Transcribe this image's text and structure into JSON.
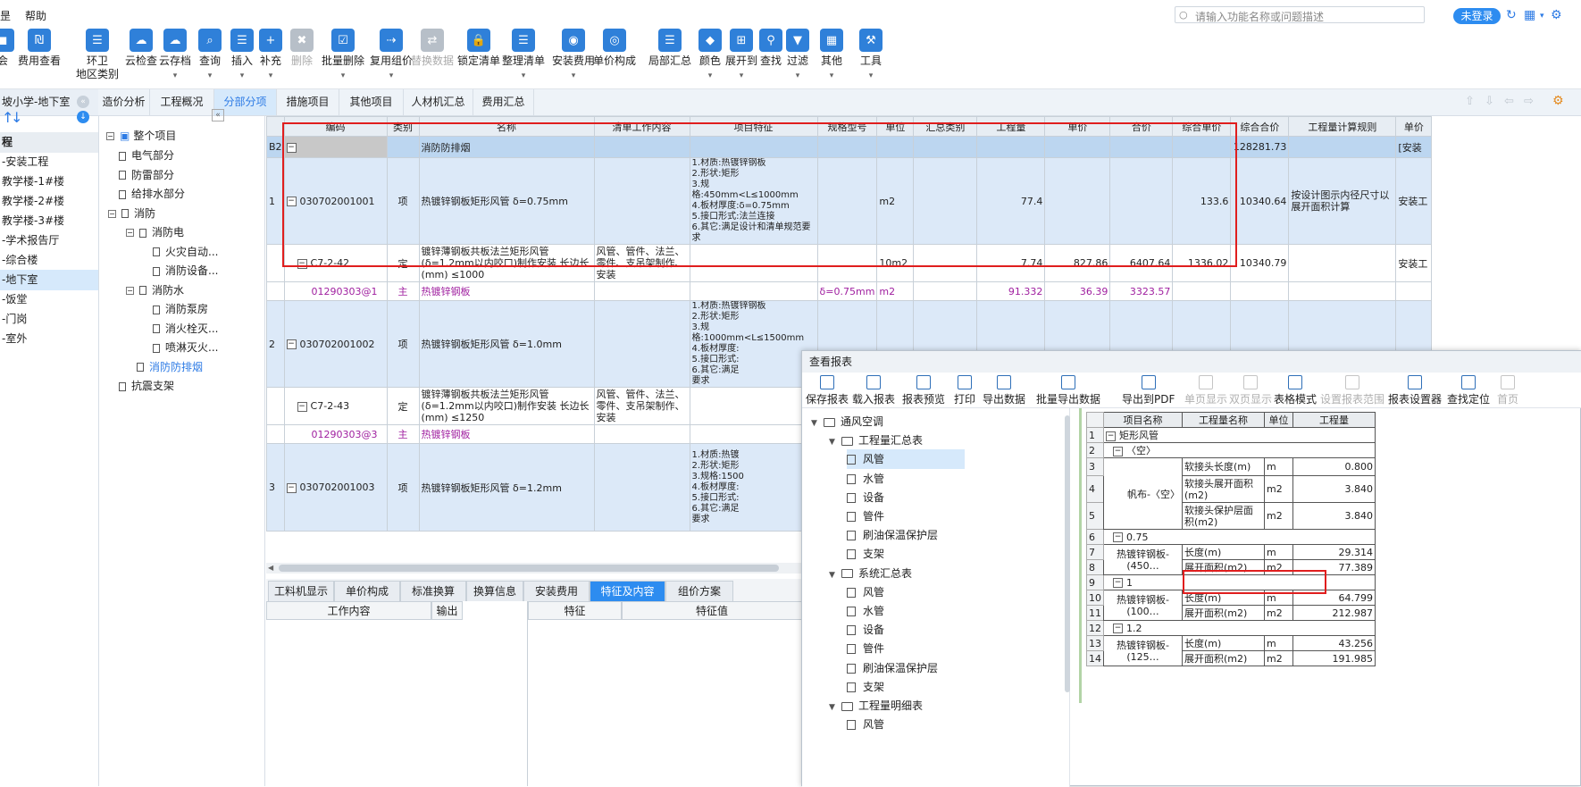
{
  "menubar": {
    "left_stub": "昰",
    "help": "帮助",
    "search_placeholder": "请输入功能名称或问题描述",
    "login": "未登录"
  },
  "toolbar": [
    {
      "label": "会",
      "sub": "",
      "dis": false
    },
    {
      "label": "费用查看",
      "sub": "",
      "dis": false
    },
    {
      "label": "环卫",
      "sub": "地区类别",
      "dis": false
    },
    {
      "label": "云检查",
      "sub": "",
      "dis": false
    },
    {
      "label": "云存档",
      "sub": "▾",
      "dis": false
    },
    {
      "label": "查询",
      "sub": "▾",
      "dis": false
    },
    {
      "label": "插入",
      "sub": "▾",
      "dis": false
    },
    {
      "label": "补充",
      "sub": "▾",
      "dis": false
    },
    {
      "label": "删除",
      "sub": "",
      "dis": true
    },
    {
      "label": "批量删除",
      "sub": "▾",
      "dis": false
    },
    {
      "label": "复用组价",
      "sub": "▾",
      "dis": false
    },
    {
      "label": "替换数据",
      "sub": "",
      "dis": true
    },
    {
      "label": "锁定清单",
      "sub": "",
      "dis": false
    },
    {
      "label": "整理清单",
      "sub": "▾",
      "dis": false
    },
    {
      "label": "安装费用",
      "sub": "▾",
      "dis": false
    },
    {
      "label": "单价构成",
      "sub": "",
      "dis": false
    },
    {
      "label": "局部汇总",
      "sub": "",
      "dis": false
    },
    {
      "label": "颜色",
      "sub": "▾",
      "dis": false
    },
    {
      "label": "展开到",
      "sub": "▾",
      "dis": false
    },
    {
      "label": "查找",
      "sub": "",
      "dis": false
    },
    {
      "label": "过滤",
      "sub": "▾",
      "dis": false
    },
    {
      "label": "其他",
      "sub": "▾",
      "dis": false
    },
    {
      "label": "工具",
      "sub": "▾",
      "dis": false
    }
  ],
  "project_name": "坡小学-地下室",
  "tabs": [
    "造价分析",
    "工程概况",
    "分部分项",
    "措施项目",
    "其他项目",
    "人材机汇总",
    "费用汇总"
  ],
  "active_tab": "分部分项",
  "left_nav": [
    "程",
    "-安装工程",
    "教学楼-1#楼",
    "教学楼-2#楼",
    "教学楼-3#楼",
    "-学术报告厅",
    "-综合楼",
    "-地下室",
    "-饭堂",
    "-门岗",
    "-室外"
  ],
  "tree": {
    "root": "整个项目",
    "items": [
      {
        "label": "电气部分"
      },
      {
        "label": "防雷部分"
      },
      {
        "label": "给排水部分"
      },
      {
        "label": "消防"
      },
      {
        "label": "消防电"
      },
      {
        "label": "火灾自动..."
      },
      {
        "label": "消防设备..."
      },
      {
        "label": "消防水"
      },
      {
        "label": "消防泵房"
      },
      {
        "label": "消火栓灭..."
      },
      {
        "label": "喷淋灭火..."
      },
      {
        "label": "消防防排烟"
      },
      {
        "label": "抗震支架"
      }
    ]
  },
  "grid": {
    "headers": [
      "",
      "编码",
      "类别",
      "名称",
      "清单工作内容",
      "项目特征",
      "规格型号",
      "单位",
      "汇总类别",
      "工程量",
      "单价",
      "合价",
      "综合单价",
      "综合合价",
      "工程量计算规则",
      "单价"
    ],
    "b2": {
      "rn": "B2",
      "name": "消防防排烟",
      "total": "128281.73",
      "tail": "[安装"
    },
    "rows": [
      {
        "rn": "1",
        "code": "030702001001",
        "type": "项",
        "name": "热镀锌钢板矩形风管  δ=0.75mm",
        "feature": "1.材质:热镀锌钢板\n2.形状:矩形\n3.规格:450mm<L≤1000mm\n4.板材厚度:δ=0.75mm\n5.接口形式:法兰连接\n6.其它:满足设计和清单规范要求",
        "unit": "m2",
        "qty": "77.4",
        "unit_price": "",
        "price": "",
        "comp_unit": "133.6",
        "comp_total": "10340.64",
        "rule": "按设计图示内径尺寸以展开面积计算",
        "tail": "安装工"
      },
      {
        "rn": "",
        "code": "C7-2-42",
        "type": "定",
        "name": "镀锌薄钢板共板法兰矩形风管(δ=1.2mm以内咬口)制作安装 长边长(mm) ≤1000",
        "work": "风管、管件、法兰、零件、支吊架制作、安装",
        "unit": "10m2",
        "qty": "7.74",
        "unit_price": "827.86",
        "price": "6407.64",
        "comp_unit": "1336.02",
        "comp_total": "10340.79",
        "tail": "安装工"
      },
      {
        "rn": "",
        "code": "01290303@1",
        "type": "主",
        "name": "热镀锌钢板",
        "spec": "δ=0.75mm",
        "unit": "m2",
        "qty": "91.332",
        "unit_price": "36.39",
        "price": "3323.57"
      },
      {
        "rn": "2",
        "code": "030702001002",
        "type": "项",
        "name": "热镀锌钢板矩形风管  δ=1.0mm",
        "feature": "1.材质:热镀锌钢板\n2.形状:矩形\n3.规格:1000mm<L≤1500mm\n4.板材厚度:\n5.接口形式:\n6.其它:满足\n要求"
      },
      {
        "rn": "",
        "code": "C7-2-43",
        "type": "定",
        "name": "镀锌薄钢板共板法兰矩形风管(δ=1.2mm以内咬口)制作安装 长边长(mm) ≤1250",
        "work": "风管、管件、法兰、零件、支吊架制作、安装"
      },
      {
        "rn": "",
        "code": "01290303@3",
        "type": "主",
        "name": "热镀锌钢板"
      },
      {
        "rn": "3",
        "code": "030702001003",
        "type": "项",
        "name": "热镀锌钢板矩形风管  δ=1.2mm",
        "feature": "1.材质:热镀\n2.形状:矩形\n3.规格:1500\n4.板材厚度:\n5.接口形式:\n6.其它:满足\n要求"
      }
    ]
  },
  "bottom_tabs": [
    "工料机显示",
    "单价构成",
    "标准换算",
    "换算信息",
    "安装费用",
    "特征及内容",
    "组价方案"
  ],
  "bottom_active": "特征及内容",
  "bottom_headers": {
    "left": [
      "工作内容",
      "输出"
    ],
    "right": [
      "特征",
      "特征值"
    ]
  },
  "dialog": {
    "title": "查看报表",
    "toolbar": [
      {
        "label": "保存报表",
        "dis": false
      },
      {
        "label": "载入报表",
        "dis": false
      },
      {
        "label": "报表预览",
        "dis": false
      },
      {
        "label": "打印",
        "dis": false
      },
      {
        "label": "导出数据",
        "dis": false
      },
      {
        "label": "批量导出数据",
        "dis": false
      },
      {
        "label": "导出到PDF",
        "dis": false
      },
      {
        "label": "单页显示",
        "dis": true
      },
      {
        "label": "双页显示",
        "dis": true
      },
      {
        "label": "表格模式",
        "dis": false
      },
      {
        "label": "设置报表范围",
        "dis": true
      },
      {
        "label": "报表设置器",
        "dis": false
      },
      {
        "label": "查找定位",
        "dis": false
      },
      {
        "label": "首页",
        "dis": true
      }
    ],
    "tree": [
      {
        "label": "通风空调",
        "lvl": 0,
        "kind": "fold"
      },
      {
        "label": "工程量汇总表",
        "lvl": 1,
        "kind": "fold"
      },
      {
        "label": "风管",
        "lvl": 2,
        "kind": "doc",
        "sel": true
      },
      {
        "label": "水管",
        "lvl": 2,
        "kind": "doc"
      },
      {
        "label": "设备",
        "lvl": 2,
        "kind": "doc"
      },
      {
        "label": "管件",
        "lvl": 2,
        "kind": "doc"
      },
      {
        "label": "刷油保温保护层",
        "lvl": 2,
        "kind": "doc"
      },
      {
        "label": "支架",
        "lvl": 2,
        "kind": "doc"
      },
      {
        "label": "系统汇总表",
        "lvl": 1,
        "kind": "fold"
      },
      {
        "label": "风管",
        "lvl": 2,
        "kind": "doc"
      },
      {
        "label": "水管",
        "lvl": 2,
        "kind": "doc"
      },
      {
        "label": "设备",
        "lvl": 2,
        "kind": "doc"
      },
      {
        "label": "管件",
        "lvl": 2,
        "kind": "doc"
      },
      {
        "label": "刷油保温保护层",
        "lvl": 2,
        "kind": "doc"
      },
      {
        "label": "支架",
        "lvl": 2,
        "kind": "doc"
      },
      {
        "label": "工程量明细表",
        "lvl": 1,
        "kind": "fold"
      },
      {
        "label": "风管",
        "lvl": 2,
        "kind": "doc"
      }
    ],
    "report_headers": [
      "项目名称",
      "工程量名称",
      "单位",
      "工程量"
    ],
    "report": {
      "r1": "矩形风管",
      "r2": "〈空〉",
      "fabric": "帆布-〈空〉",
      "fabric_rows": [
        {
          "n": "软接头长度(m)",
          "u": "m",
          "v": "0.800"
        },
        {
          "n": "软接头展开面积(m2)",
          "u": "m2",
          "v": "3.840"
        },
        {
          "n": "软接头保护层面积(m2)",
          "u": "m2",
          "v": "3.840"
        }
      ],
      "g1": "0.75",
      "g1_name": "热镀锌钢板-(450…",
      "g1_rows": [
        {
          "n": "长度(m)",
          "u": "m",
          "v": "29.314"
        },
        {
          "n": "展开面积(m2)",
          "u": "m2",
          "v": "77.389"
        }
      ],
      "g2": "1",
      "g2_name": "热镀锌钢板-(100…",
      "g2_rows": [
        {
          "n": "长度(m)",
          "u": "m",
          "v": "64.799"
        },
        {
          "n": "展开面积(m2)",
          "u": "m2",
          "v": "212.987"
        }
      ],
      "g3": "1.2",
      "g3_name": "热镀锌钢板-(125…",
      "g3_rows": [
        {
          "n": "长度(m)",
          "u": "m",
          "v": "43.256"
        },
        {
          "n": "展开面积(m2)",
          "u": "m2",
          "v": "191.985"
        }
      ]
    }
  }
}
